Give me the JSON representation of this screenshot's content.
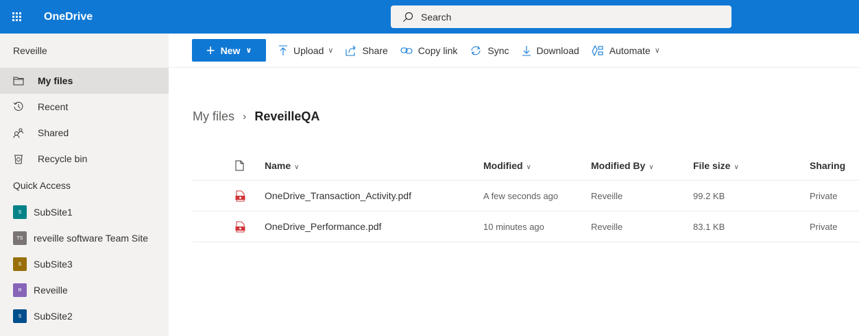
{
  "app": {
    "title": "OneDrive"
  },
  "search": {
    "placeholder": "Search"
  },
  "sidebar": {
    "header": "Reveille",
    "items": [
      {
        "label": "My files",
        "icon": "folder-icon",
        "active": true
      },
      {
        "label": "Recent",
        "icon": "clock-icon",
        "active": false
      },
      {
        "label": "Shared",
        "icon": "people-icon",
        "active": false
      },
      {
        "label": "Recycle bin",
        "icon": "recycle-bin-icon",
        "active": false
      }
    ],
    "quick_access_header": "Quick Access",
    "sites": [
      {
        "label": "SubSite1",
        "badge": "S",
        "color": "#038387"
      },
      {
        "label": "reveille software Team Site",
        "badge": "TS",
        "color": "#7a7574"
      },
      {
        "label": "SubSite3",
        "badge": "S",
        "color": "#986f0b"
      },
      {
        "label": "Reveille",
        "badge": "R",
        "color": "#8764b8"
      },
      {
        "label": "SubSite2",
        "badge": "S",
        "color": "#004e8c"
      }
    ]
  },
  "commands": {
    "new_label": "New",
    "upload_label": "Upload",
    "share_label": "Share",
    "copy_link_label": "Copy link",
    "sync_label": "Sync",
    "download_label": "Download",
    "automate_label": "Automate"
  },
  "breadcrumb": {
    "parent": "My files",
    "current": "ReveilleQA"
  },
  "table": {
    "headers": {
      "name": "Name",
      "modified": "Modified",
      "modified_by": "Modified By",
      "file_size": "File size",
      "sharing": "Sharing"
    },
    "rows": [
      {
        "name": "OneDrive_Transaction_Activity.pdf",
        "modified": "A few seconds ago",
        "modified_by": "Reveille",
        "file_size": "99.2 KB",
        "sharing": "Private"
      },
      {
        "name": "OneDrive_Performance.pdf",
        "modified": "10 minutes ago",
        "modified_by": "Reveille",
        "file_size": "83.1 KB",
        "sharing": "Private"
      }
    ]
  },
  "colors": {
    "brand": "#0f78d4",
    "sidebar_bg": "#f3f2f1",
    "pdf_red": "#d13438"
  }
}
